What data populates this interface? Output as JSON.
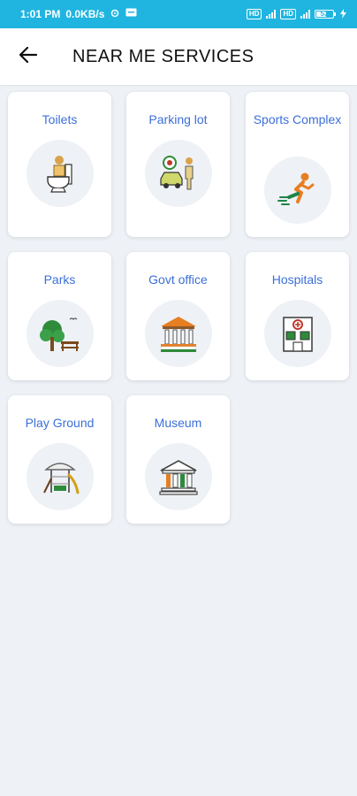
{
  "status_bar": {
    "time": "1:01 PM",
    "speed": "0.0KB/s",
    "battery": "53",
    "colors": {
      "background": "#1fb5e0"
    }
  },
  "app_bar": {
    "title": "NEAR ME SERVICES",
    "back_icon": "arrow-left-icon"
  },
  "services": [
    {
      "label": "Toilets",
      "icon": "toilet-icon"
    },
    {
      "label": "Parking lot",
      "icon": "parking-icon"
    },
    {
      "label": "Sports Complex",
      "icon": "runner-icon"
    },
    {
      "label": "Parks",
      "icon": "park-tree-icon"
    },
    {
      "label": "Govt office",
      "icon": "govt-building-icon"
    },
    {
      "label": "Hospitals",
      "icon": "hospital-icon"
    },
    {
      "label": "Play Ground",
      "icon": "playground-icon"
    },
    {
      "label": "Museum",
      "icon": "museum-icon"
    }
  ],
  "colors": {
    "accent": "#3b6fd8",
    "page_background": "#eef2f7",
    "card_background": "#ffffff"
  }
}
